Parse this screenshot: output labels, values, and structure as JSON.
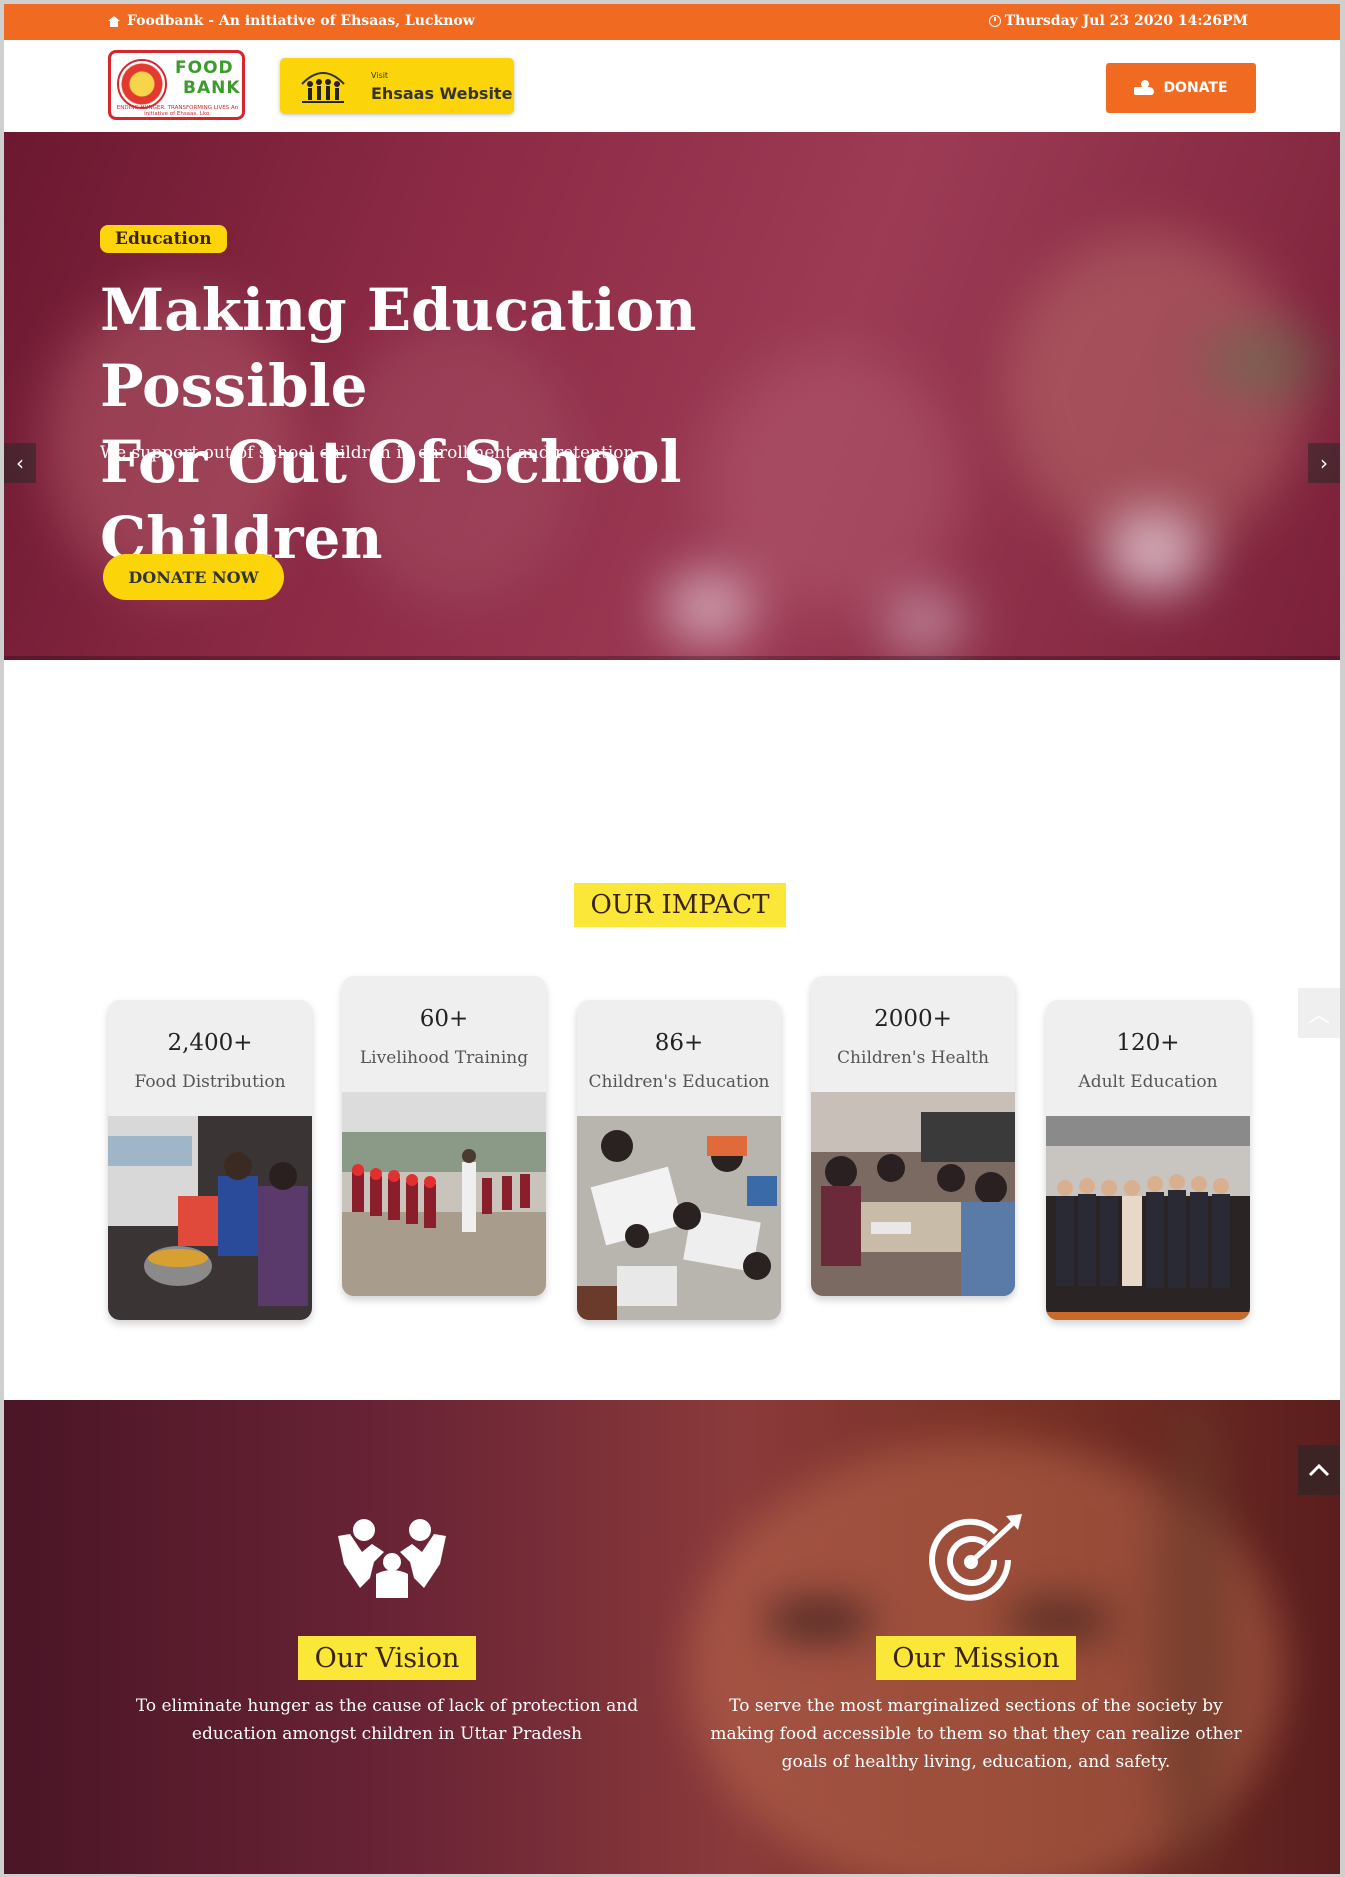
{
  "topbar": {
    "left_text": "Foodbank - An initiative of Ehsaas, Lucknow",
    "datetime": "Thursday Jul 23 2020 14:26PM"
  },
  "header": {
    "logo": {
      "line1": "FOOD",
      "line2": "BANK",
      "tagline": "ENDING HUNGER, TRANSFORMING LIVES  An initiative of Ehsaas, Lko."
    },
    "ehsaas_button": {
      "visit": "Visit",
      "label": "Ehsaas Website"
    },
    "donate_label": "DONATE"
  },
  "hero": {
    "tag": "Education",
    "title_line1": "Making Education Possible",
    "title_line2": "For Out Of School Children",
    "subtitle": "We support out of school children in enrollment and retention.",
    "cta": "DONATE NOW",
    "slides_total": 4,
    "active_slide": 2
  },
  "impact": {
    "title": "OUR IMPACT",
    "cards": [
      {
        "value": "2,400+",
        "label": "Food Distribution"
      },
      {
        "value": "60+",
        "label": "Livelihood Training"
      },
      {
        "value": "86+",
        "label": "Children's Education"
      },
      {
        "value": "2000+",
        "label": "Children's Health"
      },
      {
        "value": "120+",
        "label": "Adult Education"
      }
    ]
  },
  "vision": {
    "title": "Our Vision",
    "text": "To eliminate hunger as the cause of lack of protection and education amongst children in Uttar Pradesh"
  },
  "mission": {
    "title": "Our Mission",
    "text": "To serve the most marginalized sections of the society by making food accessible to them so that they can realize other goals of healthy living, education, and safety."
  },
  "colors": {
    "orange": "#f06a22",
    "yellow": "#fbd40a",
    "title_yellow": "#fbe737",
    "maroon": "#6b1830"
  },
  "icons": [
    "home-icon",
    "clock-icon",
    "hand-heart-icon",
    "chevron-left-icon",
    "chevron-right-icon",
    "chevron-up-icon",
    "family-icon",
    "target-icon"
  ]
}
